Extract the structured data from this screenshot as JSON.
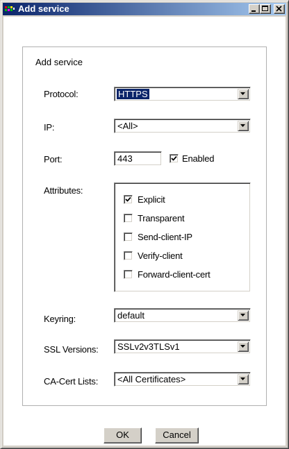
{
  "window": {
    "title": "Add service",
    "icon": "app-icon",
    "controls": [
      "minimize-icon",
      "maximize-icon",
      "close-icon"
    ]
  },
  "group": {
    "legend": "Add service"
  },
  "form": {
    "protocol": {
      "label": "Protocol:",
      "value": "HTTPS"
    },
    "ip": {
      "label": "IP:",
      "value": "<All>"
    },
    "port": {
      "label": "Port:",
      "value": "443",
      "enabled_label": "Enabled",
      "enabled": true
    },
    "attributes": {
      "label": "Attributes:",
      "items": [
        {
          "label": "Explicit",
          "checked": true
        },
        {
          "label": "Transparent",
          "checked": false
        },
        {
          "label": "Send-client-IP",
          "checked": false
        },
        {
          "label": "Verify-client",
          "checked": false
        },
        {
          "label": "Forward-client-cert",
          "checked": false
        }
      ]
    },
    "keyring": {
      "label": "Keyring:",
      "value": "default"
    },
    "ssl_versions": {
      "label": "SSL Versions:",
      "value": "SSLv2v3TLSv1"
    },
    "ca_cert_lists": {
      "label": "CA-Cert Lists:",
      "value": "<All Certificates>"
    }
  },
  "buttons": {
    "ok": "OK",
    "cancel": "Cancel"
  }
}
